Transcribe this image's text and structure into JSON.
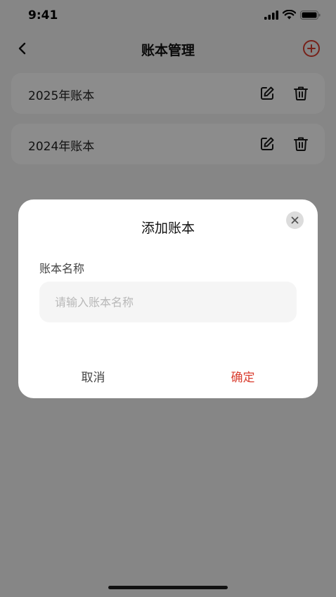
{
  "status_bar": {
    "time": "9:41"
  },
  "nav": {
    "title": "账本管理"
  },
  "books": [
    {
      "name": "2025年账本"
    },
    {
      "name": "2024年账本"
    }
  ],
  "dialog": {
    "title": "添加账本",
    "field_label": "账本名称",
    "input_value": "",
    "input_placeholder": "请输入账本名称",
    "cancel_label": "取消",
    "confirm_label": "确定"
  },
  "colors": {
    "accent": "#d93d2f",
    "background": "#f4f4f4",
    "card": "#ffffff"
  },
  "icons": [
    "back-icon",
    "add-circle-icon",
    "edit-icon",
    "trash-icon",
    "close-icon",
    "signal-icon",
    "wifi-icon",
    "battery-icon"
  ]
}
